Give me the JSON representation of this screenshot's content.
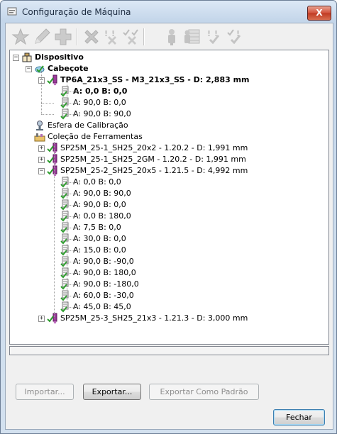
{
  "window": {
    "title": "Configuração de Máquina",
    "close_label": "X"
  },
  "toolbar": {
    "buttons": [
      {
        "icon": "star-icon",
        "enabled": false
      },
      {
        "icon": "pencil-icon",
        "enabled": false
      },
      {
        "icon": "plus-icon",
        "enabled": false
      },
      {
        "icon": "delete-x-icon",
        "enabled": false
      },
      {
        "icon": "x-marks-icon",
        "enabled": false
      },
      {
        "icon": "check-x-icon",
        "enabled": false
      },
      {
        "icon": "probe-icon",
        "enabled": false
      },
      {
        "icon": "table-probe-icon",
        "enabled": false
      },
      {
        "icon": "exclaim-check-icon",
        "enabled": false
      },
      {
        "icon": "check-check-icon",
        "enabled": false
      }
    ]
  },
  "tree": {
    "root": "Dispositivo",
    "head": "Cabeçote",
    "head_probe": "TP6A_21x3_SS - M3_21x3_SS - D: 2,883 mm",
    "head_tips": [
      "A: 0,0 B: 0,0",
      "A: 90,0 B: 0,0",
      "A: 90,0 B: 90,0"
    ],
    "calibration_sphere": "Esfera de Calibração",
    "tool_collection": "Coleção de Ferramentas",
    "tools": [
      "SP25M_25-1_SH25_20x2 - 1.20.2 - D: 1,991 mm",
      "SP25M_25-1_SH25_2GM - 1.20.2 - D: 1,991 mm",
      "SP25M_25-2_SH25_20x5 - 1.21.5 - D: 4,992 mm"
    ],
    "tool3_tips": [
      "A: 0,0 B: 0,0",
      "A: 90,0 B: 90,0",
      "A: 90,0 B: 0,0",
      "A: 0,0 B: 180,0",
      "A: 7,5 B: 0,0",
      "A: 30,0 B: 0,0",
      "A: 15,0 B: 0,0",
      "A: 90,0 B: -90,0",
      "A: 90,0 B: 180,0",
      "A: 90,0 B: -180,0",
      "A: 60,0 B: -30,0",
      "A: 45,0 B: 45,0"
    ],
    "tool4": "SP25M_25-3_SH25_21x3 - 1.21.3 - D: 3,000 mm"
  },
  "buttons": {
    "import": "Importar...",
    "export": "Exportar...",
    "export_default": "Exportar Como Padrão",
    "close": "Fechar"
  },
  "colors": {
    "check_green": "#3aa12e",
    "probe_purple": "#8a2a8a",
    "disabled_gray": "#b9b9b9"
  }
}
